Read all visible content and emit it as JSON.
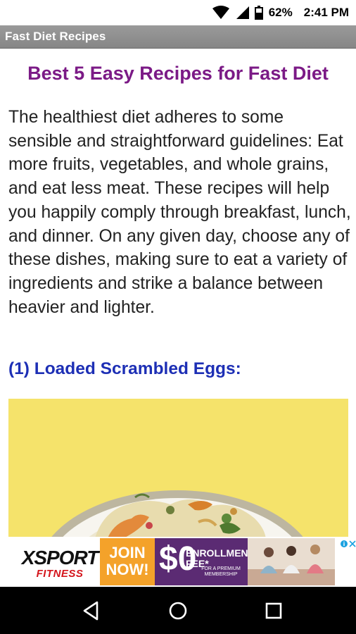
{
  "status": {
    "battery": "62%",
    "time": "2:41 PM"
  },
  "app_bar": {
    "title": "Fast Diet Recipes"
  },
  "article": {
    "title": "Best 5 Easy Recipes for Fast Diet",
    "intro": "The healthiest diet adheres to some sensible and straightforward guidelines: Eat more fruits, vegetables, and whole grains, and eat less meat. These recipes will help you happily comply through breakfast, lunch, and dinner. On any given day, choose any of these dishes, making sure to eat a variety of ingredients and strike a balance between heavier and lighter.",
    "section_heading": "(1) Loaded Scrambled Eggs:"
  },
  "ad": {
    "brand": "XSPORT",
    "brand_sub": "FITNESS",
    "join_line1": "JOIN",
    "join_line2": "NOW!",
    "dollar": "$0",
    "fee_line1": "ENROLLMENT",
    "fee_line2": "FEE*",
    "fee_small": "FOR A PREMIUM MEMBERSHIP"
  },
  "colors": {
    "title": "#7b1a86",
    "heading": "#1d2fb5",
    "app_bar": "#8f8f8f",
    "image_bg": "#f5e36b"
  },
  "icons": [
    "wifi-icon",
    "cell-signal-icon",
    "battery-icon",
    "ad-info-icon",
    "ad-close-icon",
    "back-icon",
    "home-icon",
    "recents-icon"
  ]
}
